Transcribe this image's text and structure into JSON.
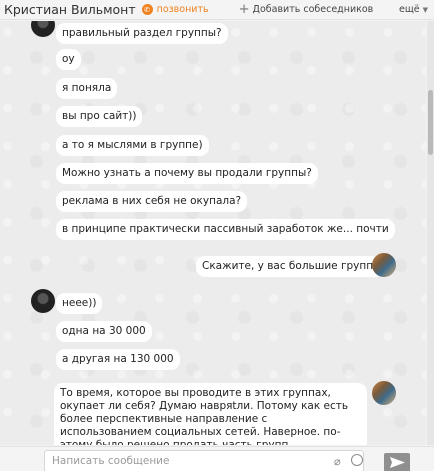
{
  "header": {
    "chat_name": "Кристиан Вильмонт",
    "call_label": "позвонить",
    "add_label": "Добавить собеседников",
    "more_label": "ещё"
  },
  "messages": [
    {
      "text": "правильный раздел группы?",
      "side": "left"
    },
    {
      "text": "оу",
      "side": "left"
    },
    {
      "text": "я поняла",
      "side": "left"
    },
    {
      "text": "вы про сайт))",
      "side": "left"
    },
    {
      "text": "а то я мыслями в группе)",
      "side": "left"
    },
    {
      "text": "Можно узнать а почему вы продали группы?",
      "side": "left"
    },
    {
      "text": "реклама в них себя не окупала?",
      "side": "left"
    },
    {
      "text": "в принципе практически пассивный заработок же... почти",
      "side": "left"
    },
    {
      "text": "Скажите, у вас большие группы?",
      "side": "right"
    },
    {
      "text": "неее))",
      "side": "left"
    },
    {
      "text": "одна на 30 000",
      "side": "left"
    },
    {
      "text": "а другая на 130 000",
      "side": "left"
    },
    {
      "text": "То время, которое вы проводите в этих группах, окупает ли себя? Думаю навряtли. Потому как есть более перспективные направление с использованием социальных сетей. Наверное. по-этому было решено продать часть групп",
      "side": "right"
    }
  ],
  "composer": {
    "placeholder": "Написать сообщение"
  },
  "icons": {
    "call": "phone-icon",
    "add": "plus-icon",
    "more": "chevron-down-icon",
    "attach": "paperclip-icon",
    "emoji": "smile-icon",
    "send": "send-icon"
  }
}
